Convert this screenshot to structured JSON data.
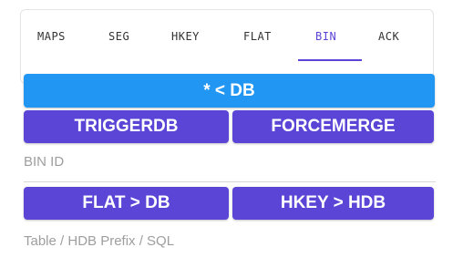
{
  "tabs": [
    {
      "label": "MAPS",
      "active": false
    },
    {
      "label": "SEG",
      "active": false
    },
    {
      "label": "HKEY",
      "active": false
    },
    {
      "label": "FLAT",
      "active": false
    },
    {
      "label": "BIN",
      "active": true
    },
    {
      "label": "ACK",
      "active": false
    }
  ],
  "buttons": {
    "all_to_db": "* < DB",
    "triggerdb": "TRIGGERDB",
    "forcemerge": "FORCEMERGE",
    "flat_to_db": "FLAT > DB",
    "hkey_to_hdb": "HKEY > HDB"
  },
  "fields": {
    "bin_id_placeholder": "BIN ID",
    "table_prefix_placeholder": "Table / HDB Prefix / SQL"
  },
  "colors": {
    "accent_purple": "#5b45d6",
    "accent_blue": "#2196f3"
  }
}
